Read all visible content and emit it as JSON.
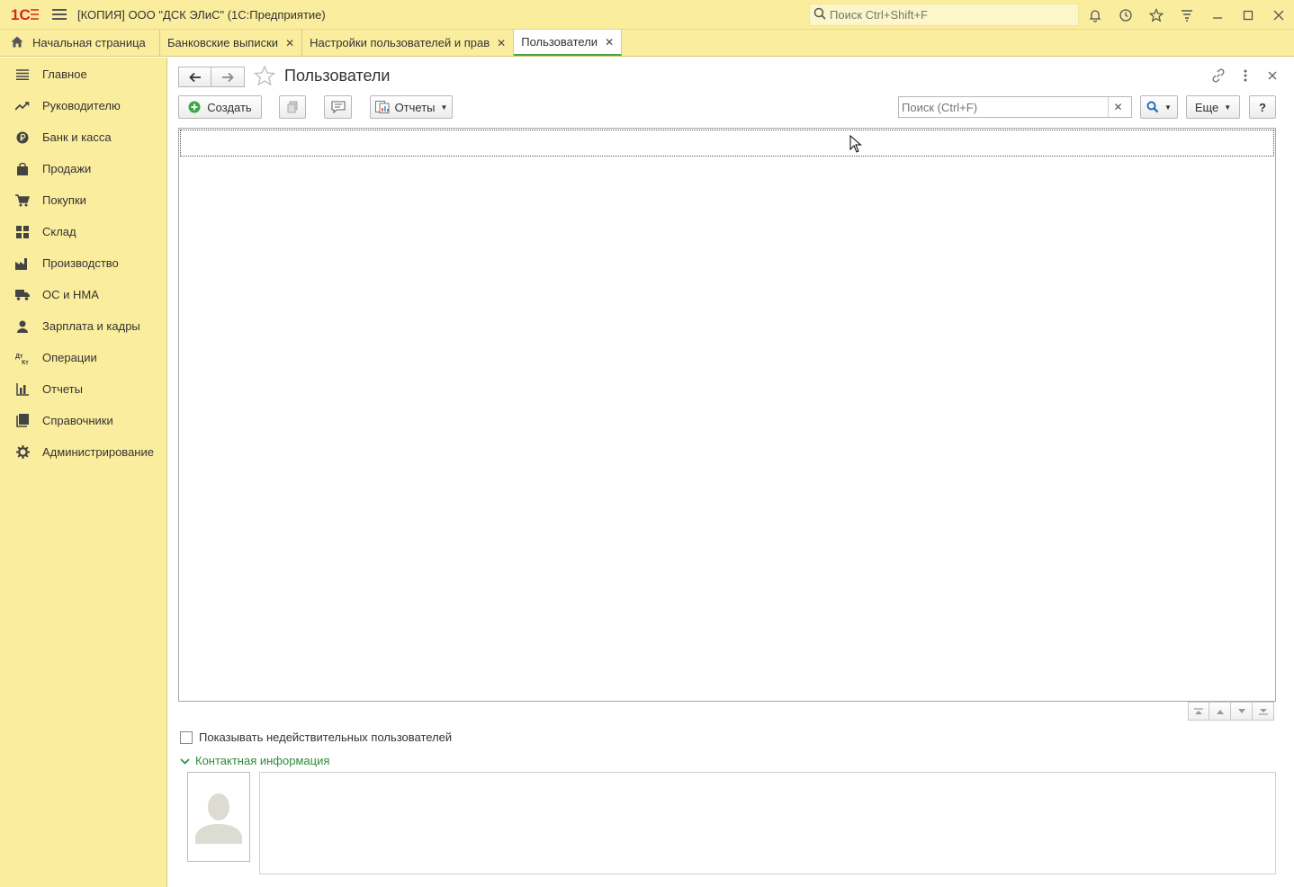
{
  "app": {
    "title": "[КОПИЯ] ООО \"ДСК ЭЛиС\"  (1С:Предприятие)",
    "global_search_placeholder": "Поиск Ctrl+Shift+F"
  },
  "tabs": [
    {
      "label": "Начальная страница"
    },
    {
      "label": "Банковские выписки"
    },
    {
      "label": "Настройки пользователей и прав"
    },
    {
      "label": "Пользователи"
    }
  ],
  "sidebar": {
    "items": [
      {
        "label": "Главное",
        "icon": "hamburger-icon"
      },
      {
        "label": "Руководителю",
        "icon": "trend-icon"
      },
      {
        "label": "Банк и касса",
        "icon": "ruble-icon"
      },
      {
        "label": "Продажи",
        "icon": "bag-icon"
      },
      {
        "label": "Покупки",
        "icon": "cart-icon"
      },
      {
        "label": "Склад",
        "icon": "warehouse-icon"
      },
      {
        "label": "Производство",
        "icon": "factory-icon"
      },
      {
        "label": "ОС и НМА",
        "icon": "truck-icon"
      },
      {
        "label": "Зарплата и кадры",
        "icon": "person-icon"
      },
      {
        "label": "Операции",
        "icon": "dt-kt-icon"
      },
      {
        "label": "Отчеты",
        "icon": "bar-chart-icon"
      },
      {
        "label": "Справочники",
        "icon": "books-icon"
      },
      {
        "label": "Администрирование",
        "icon": "gear-icon"
      }
    ]
  },
  "form": {
    "title": "Пользователи",
    "create_label": "Создать",
    "reports_label": "Отчеты",
    "search_placeholder": "Поиск (Ctrl+F)",
    "more_label": "Еще",
    "help_label": "?",
    "show_invalid_label": "Показывать недействительных пользователей",
    "contact_group_label": "Контактная информация"
  },
  "colors": {
    "panel": "#fbed9e",
    "accent_green": "#2e8b3a",
    "logo_red": "#d6261c"
  }
}
